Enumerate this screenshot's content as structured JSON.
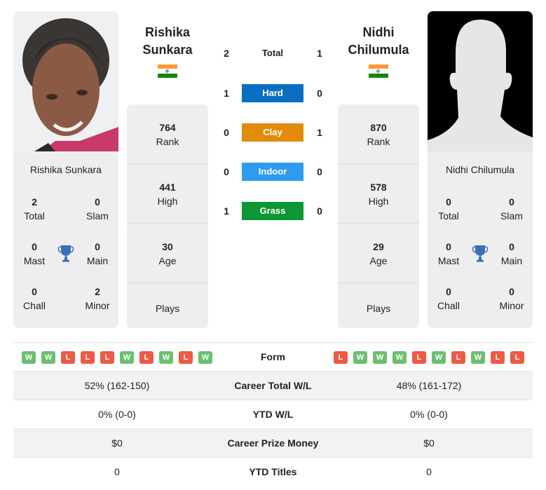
{
  "players": {
    "left": {
      "name_line1": "Rishika",
      "name_line2": "Sunkara",
      "card_name": "Rishika Sunkara",
      "country": "India",
      "flag_icon": "india-flag-icon",
      "photo": "player-photo",
      "titles": {
        "total": {
          "value": "2",
          "label": "Total"
        },
        "slam": {
          "value": "0",
          "label": "Slam"
        },
        "mast": {
          "value": "0",
          "label": "Mast"
        },
        "main": {
          "value": "0",
          "label": "Main"
        },
        "chall": {
          "value": "0",
          "label": "Chall"
        },
        "minor": {
          "value": "2",
          "label": "Minor"
        }
      },
      "stats": {
        "rank": {
          "value": "764",
          "label": "Rank"
        },
        "high": {
          "value": "441",
          "label": "High"
        },
        "age": {
          "value": "30",
          "label": "Age"
        },
        "plays": {
          "value": "",
          "label": "Plays"
        }
      }
    },
    "right": {
      "name_line1": "Nidhi",
      "name_line2": "Chilumula",
      "card_name": "Nidhi Chilumula",
      "country": "India",
      "flag_icon": "india-flag-icon",
      "photo": "placeholder-silhouette",
      "titles": {
        "total": {
          "value": "0",
          "label": "Total"
        },
        "slam": {
          "value": "0",
          "label": "Slam"
        },
        "mast": {
          "value": "0",
          "label": "Mast"
        },
        "main": {
          "value": "0",
          "label": "Main"
        },
        "chall": {
          "value": "0",
          "label": "Chall"
        },
        "minor": {
          "value": "0",
          "label": "Minor"
        }
      },
      "stats": {
        "rank": {
          "value": "870",
          "label": "Rank"
        },
        "high": {
          "value": "578",
          "label": "High"
        },
        "age": {
          "value": "29",
          "label": "Age"
        },
        "plays": {
          "value": "",
          "label": "Plays"
        }
      }
    }
  },
  "h2h": [
    {
      "label": "Total",
      "left": "2",
      "right": "1",
      "color": ""
    },
    {
      "label": "Hard",
      "left": "1",
      "right": "0",
      "color": "#0a6fc2"
    },
    {
      "label": "Clay",
      "left": "0",
      "right": "1",
      "color": "#e08c0a"
    },
    {
      "label": "Indoor",
      "left": "0",
      "right": "0",
      "color": "#2d9bf0"
    },
    {
      "label": "Grass",
      "left": "1",
      "right": "0",
      "color": "#0c9636"
    }
  ],
  "comparison": {
    "form": {
      "label": "Form",
      "left": [
        "W",
        "W",
        "L",
        "L",
        "L",
        "W",
        "L",
        "W",
        "L",
        "W"
      ],
      "right": [
        "L",
        "W",
        "W",
        "W",
        "L",
        "W",
        "L",
        "W",
        "L",
        "L"
      ]
    },
    "rows": [
      {
        "label": "Career Total W/L",
        "left": "52% (162-150)",
        "right": "48% (161-172)"
      },
      {
        "label": "YTD W/L",
        "left": "0% (0-0)",
        "right": "0% (0-0)"
      },
      {
        "label": "Career Prize Money",
        "left": "$0",
        "right": "$0"
      },
      {
        "label": "YTD Titles",
        "left": "0",
        "right": "0"
      }
    ]
  },
  "colors": {
    "win": "#6cbf6f",
    "loss": "#ee5a45",
    "trophy": "#3a6fba",
    "card_bg": "#eeeeee"
  }
}
